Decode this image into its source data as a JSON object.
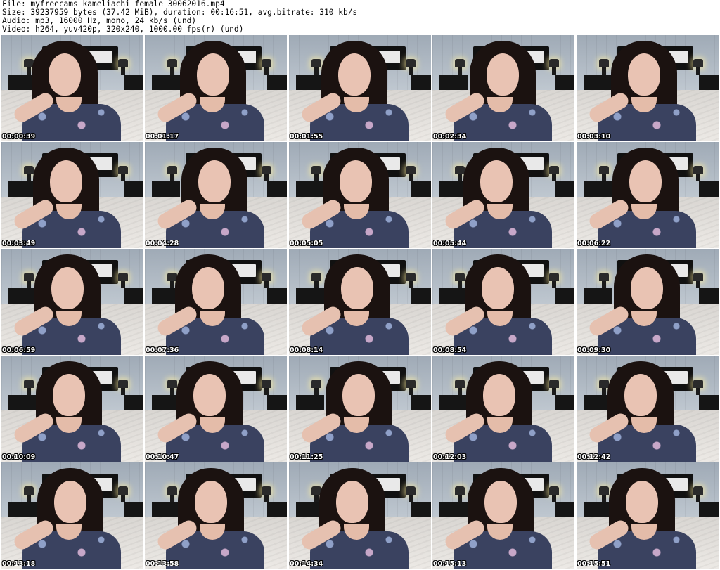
{
  "header": {
    "file_line": "File: myfreecams_kameliachi_female_30062016.mp4",
    "size_line": "Size: 39237959 bytes (37.42 MiB), duration: 00:16:51, avg.bitrate: 310 kb/s",
    "audio_line": "Audio: mp3, 16000 Hz, mono, 24 kb/s (und)",
    "video_line": "Video: h264, yuv420p, 320x240, 1000.00 fps(r) (und)"
  },
  "thumbnails": [
    {
      "time": "00:00:39"
    },
    {
      "time": "00:01:17"
    },
    {
      "time": "00:01:55"
    },
    {
      "time": "00:02:34"
    },
    {
      "time": "00:03:10"
    },
    {
      "time": "00:03:49"
    },
    {
      "time": "00:04:28"
    },
    {
      "time": "00:05:05"
    },
    {
      "time": "00:05:44"
    },
    {
      "time": "00:06:22"
    },
    {
      "time": "00:06:59"
    },
    {
      "time": "00:07:36"
    },
    {
      "time": "00:08:14"
    },
    {
      "time": "00:08:54"
    },
    {
      "time": "00:09:30"
    },
    {
      "time": "00:10:09"
    },
    {
      "time": "00:10:47"
    },
    {
      "time": "00:11:25"
    },
    {
      "time": "00:12:03"
    },
    {
      "time": "00:12:42"
    },
    {
      "time": "00:13:18"
    },
    {
      "time": "00:13:58"
    },
    {
      "time": "00:14:34"
    },
    {
      "time": "00:15:13"
    },
    {
      "time": "00:15:51"
    }
  ]
}
